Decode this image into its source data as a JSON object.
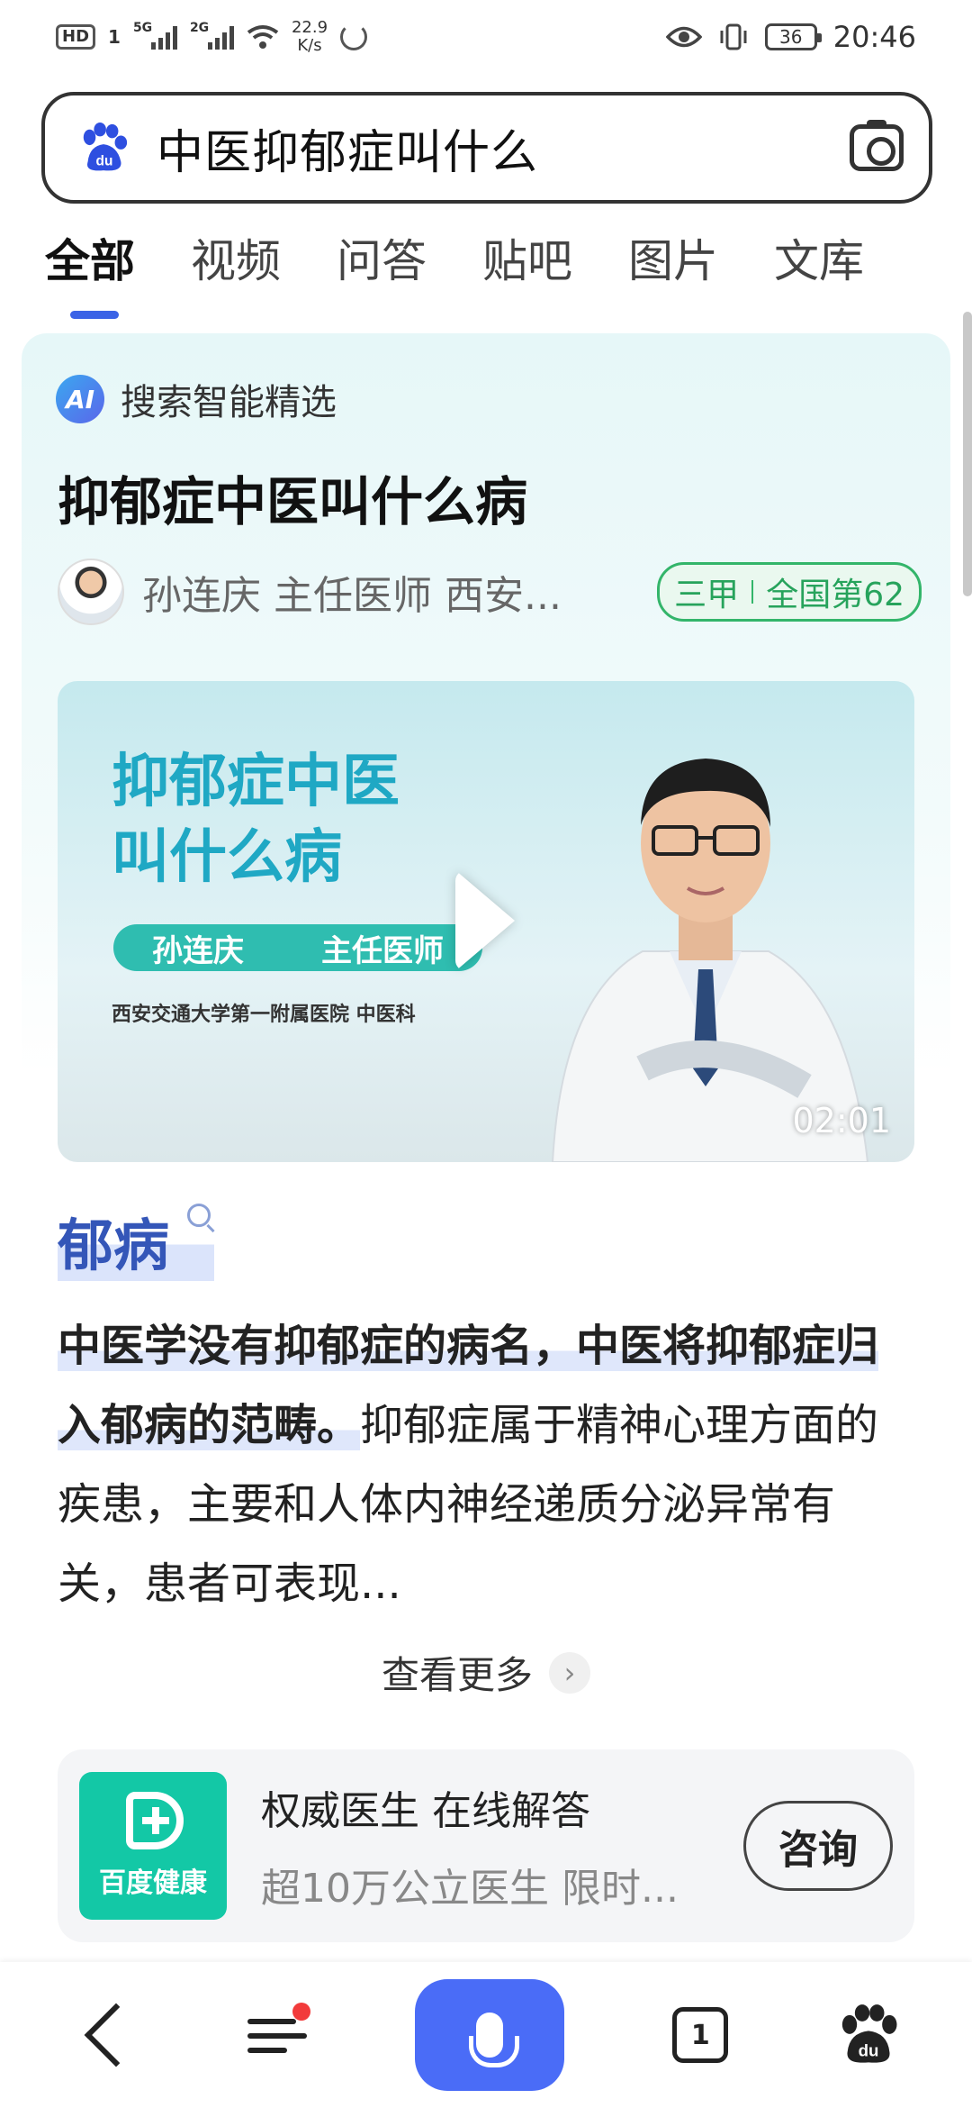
{
  "status_bar": {
    "hd_label": "HD",
    "sim1": "1",
    "network1": "5G",
    "network2": "2G",
    "speed_value": "22.9",
    "speed_unit": "K/s",
    "battery": "36",
    "time": "20:46"
  },
  "search": {
    "query": "中医抑郁症叫什么",
    "logo_icon": "baidu-paw-icon",
    "camera_icon": "camera-icon"
  },
  "tabs": [
    {
      "label": "全部",
      "active": true
    },
    {
      "label": "视频"
    },
    {
      "label": "问答"
    },
    {
      "label": "贴吧"
    },
    {
      "label": "图片"
    },
    {
      "label": "文库"
    }
  ],
  "ai_card": {
    "ai_badge": "AI",
    "ai_label": "搜索智能精选",
    "title": "抑郁症中医叫什么病",
    "doctor_line": "孙连庆 主任医师 西安...",
    "hospital_level": "三甲",
    "hospital_rank": "全国第62",
    "video": {
      "title_line1": "抑郁症中医",
      "title_line2": "叫什么病",
      "doctor_name": "孙连庆",
      "doctor_title": "主任医师",
      "subtitle": "西安交通大学第一附属医院 中医科",
      "duration": "02:01"
    },
    "keyword": "郁病",
    "answer_highlight": "中医学没有抑郁症的病名，中医将抑郁症归入郁病的范畴。",
    "answer_rest": "抑郁症属于精神心理方面的疾患，主要和人体内神经递质分泌异常有关，患者可表现...",
    "more_label": "查看更多"
  },
  "health": {
    "logo_label": "百度健康",
    "title": "权威医生 在线解答",
    "subtitle": "超10万公立医生 限时...",
    "button": "咨询"
  },
  "bottom_nav": {
    "tab_count": "1"
  },
  "colors": {
    "accent": "#3b63e6",
    "mic_button": "#4a6cf7",
    "keyword": "#3456b8",
    "badge_green": "#27a35c",
    "health_green": "#13c8a6"
  }
}
